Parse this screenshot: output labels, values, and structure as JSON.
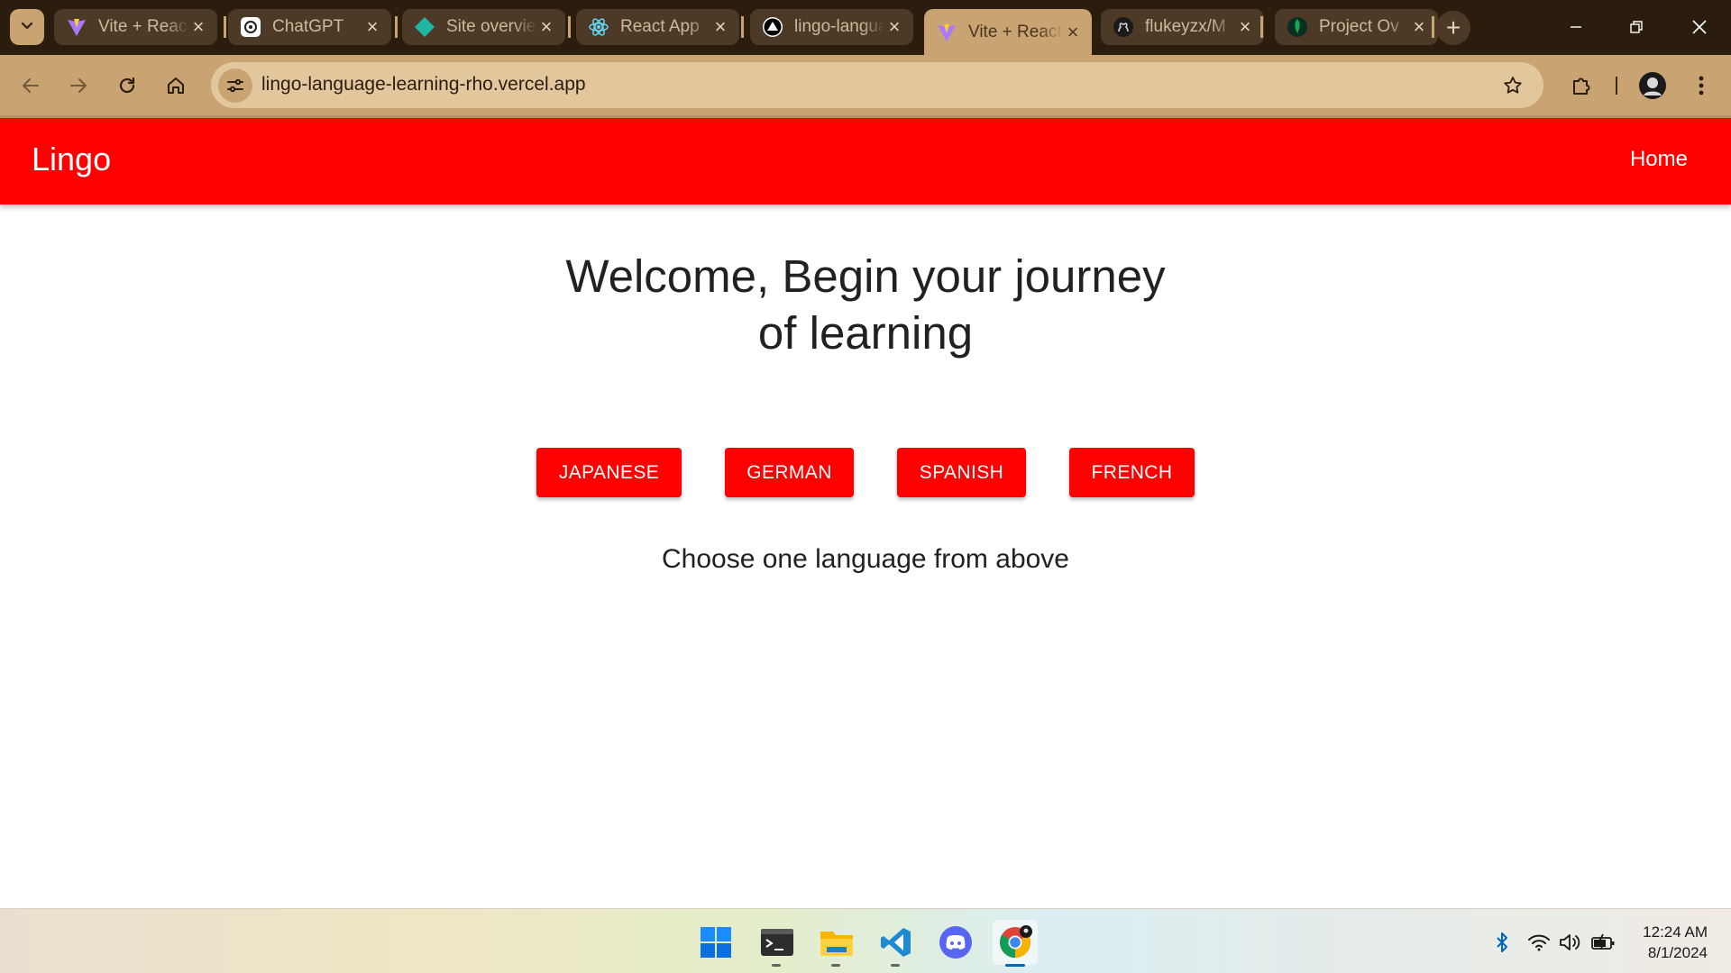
{
  "browser": {
    "tabs": [
      {
        "title": "Vite + React",
        "icon": "vite-icon"
      },
      {
        "title": "ChatGPT",
        "icon": "chatgpt-icon"
      },
      {
        "title": "Site overview",
        "icon": "netlify-icon"
      },
      {
        "title": "React App",
        "icon": "react-icon"
      },
      {
        "title": "lingo-language",
        "icon": "vercel-icon"
      },
      {
        "title": "Vite + React",
        "icon": "vite-icon",
        "active": true
      },
      {
        "title": "flukeyzx/M",
        "icon": "github-icon"
      },
      {
        "title": "Project Ov",
        "icon": "mongodb-icon"
      }
    ],
    "url": "lingo-language-learning-rho.vercel.app"
  },
  "page": {
    "brand": "Lingo",
    "nav_home": "Home",
    "headline_line1": "Welcome, Begin your journey",
    "headline_line2": "of learning",
    "languages": [
      "JAPANESE",
      "GERMAN",
      "SPANISH",
      "FRENCH"
    ],
    "hint": "Choose one language from above"
  },
  "taskbar": {
    "apps": [
      "start-icon",
      "terminal-icon",
      "file-explorer-icon",
      "vscode-icon",
      "discord-icon",
      "chrome-icon"
    ],
    "time": "12:24 AM",
    "date": "8/1/2024"
  },
  "colors": {
    "accent": "#ff0000",
    "chrome_frame": "#2b1d0e",
    "chrome_toolbar": "#c9a472"
  }
}
